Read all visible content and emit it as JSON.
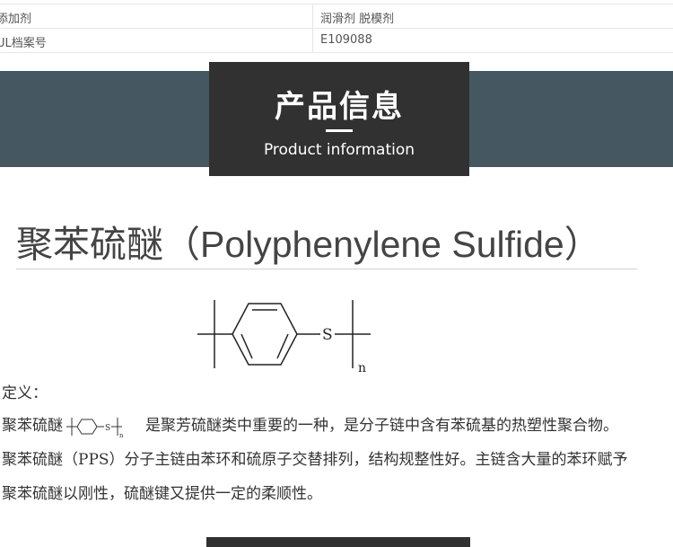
{
  "spec_rows": [
    {
      "key": "添加剂",
      "value": "润滑剂 脱模剂"
    },
    {
      "key": "UL档案号",
      "value": "E109088"
    }
  ],
  "banner": {
    "title_cn": "产品信息",
    "title_en": "Product information"
  },
  "product": {
    "title": "聚苯硫醚（Polyphenylene Sulfide）",
    "structure_atom": "S",
    "structure_subscript": "n"
  },
  "definition": {
    "heading": "定义：",
    "line1_prefix": "聚苯硫醚",
    "line1_suffix": "是聚芳硫醚类中重要的一种，是分子链中含有苯硫基的热塑性聚合物。",
    "line2": "聚苯硫醚（PPS）分子主链由苯环和硫原子交替排列，结构规整性好。主链含大量的苯环赋予",
    "line3": "聚苯硫醚以刚性，硫醚键又提供一定的柔顺性。"
  },
  "colors": {
    "banner_band": "#455760",
    "banner_box": "#313131",
    "text": "#333333"
  }
}
